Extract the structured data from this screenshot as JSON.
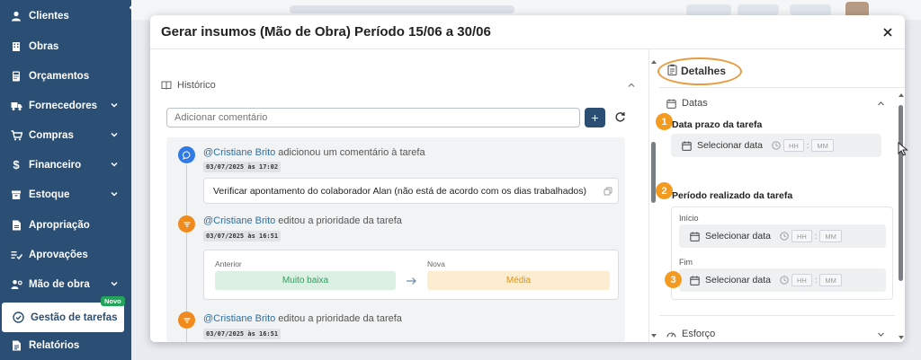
{
  "sidebar": {
    "items": [
      {
        "label": "Clientes",
        "icon": "person-icon",
        "has_chevron": false
      },
      {
        "label": "Obras",
        "icon": "building-icon",
        "has_chevron": false
      },
      {
        "label": "Orçamentos",
        "icon": "calculator-icon",
        "has_chevron": false
      },
      {
        "label": "Fornecedores",
        "icon": "truck-icon",
        "has_chevron": true
      },
      {
        "label": "Compras",
        "icon": "cart-icon",
        "has_chevron": true
      },
      {
        "label": "Financeiro",
        "icon": "dollar-icon",
        "has_chevron": true
      },
      {
        "label": "Estoque",
        "icon": "box-icon",
        "has_chevron": true
      },
      {
        "label": "Apropriação",
        "icon": "document-icon",
        "has_chevron": false
      },
      {
        "label": "Aprovações",
        "icon": "checklist-icon",
        "has_chevron": false
      },
      {
        "label": "Mão de obra",
        "icon": "people-gear-icon",
        "has_chevron": true
      },
      {
        "label": "Gestão de tarefas",
        "icon": "check-circle-icon",
        "has_chevron": false,
        "active": true
      },
      {
        "label": "Relatórios",
        "icon": "report-icon",
        "has_chevron": false
      }
    ],
    "new_badge": "Novo"
  },
  "modal": {
    "title": "Gerar insumos (Mão de Obra) Período 15/06 a 30/06"
  },
  "history": {
    "title": "Histórico",
    "comment_placeholder": "Adicionar comentário",
    "add_label": "+",
    "events": [
      {
        "user": "@Cristiane Brito",
        "action": " adicionou um comentário à tarefa",
        "date": "03/07/2025 às 17:02",
        "comment": "Verificar apontamento do colaborador Alan (não está de acordo com os dias trabalhados)"
      },
      {
        "user": "@Cristiane Brito",
        "action": " editou a prioridade da tarefa",
        "date": "03/07/2025 às 16:51",
        "previous_label": "Anterior",
        "previous_value": "Muito baixa",
        "new_label": "Nova",
        "new_value": "Média"
      },
      {
        "user": "@Cristiane Brito",
        "action": " editou a prioridade da tarefa",
        "date": "03/07/2025 às 16:51"
      }
    ]
  },
  "details": {
    "title": "Detalhes",
    "dates_section": "Datas",
    "due_label": "Data prazo da tarefa",
    "period_label": "Período realizado da tarefa",
    "start_label": "Início",
    "end_label": "Fim",
    "select_date": "Selecionar data",
    "hh": "HH",
    "mm": "MM",
    "effort_section": "Esforço",
    "markers": [
      "1",
      "2",
      "3"
    ]
  },
  "colors": {
    "sidebar_bg": "#2b4e74",
    "accent_orange": "#f39a1f",
    "primary_blue": "#2b4e74",
    "badge_green": "#22a55b"
  }
}
